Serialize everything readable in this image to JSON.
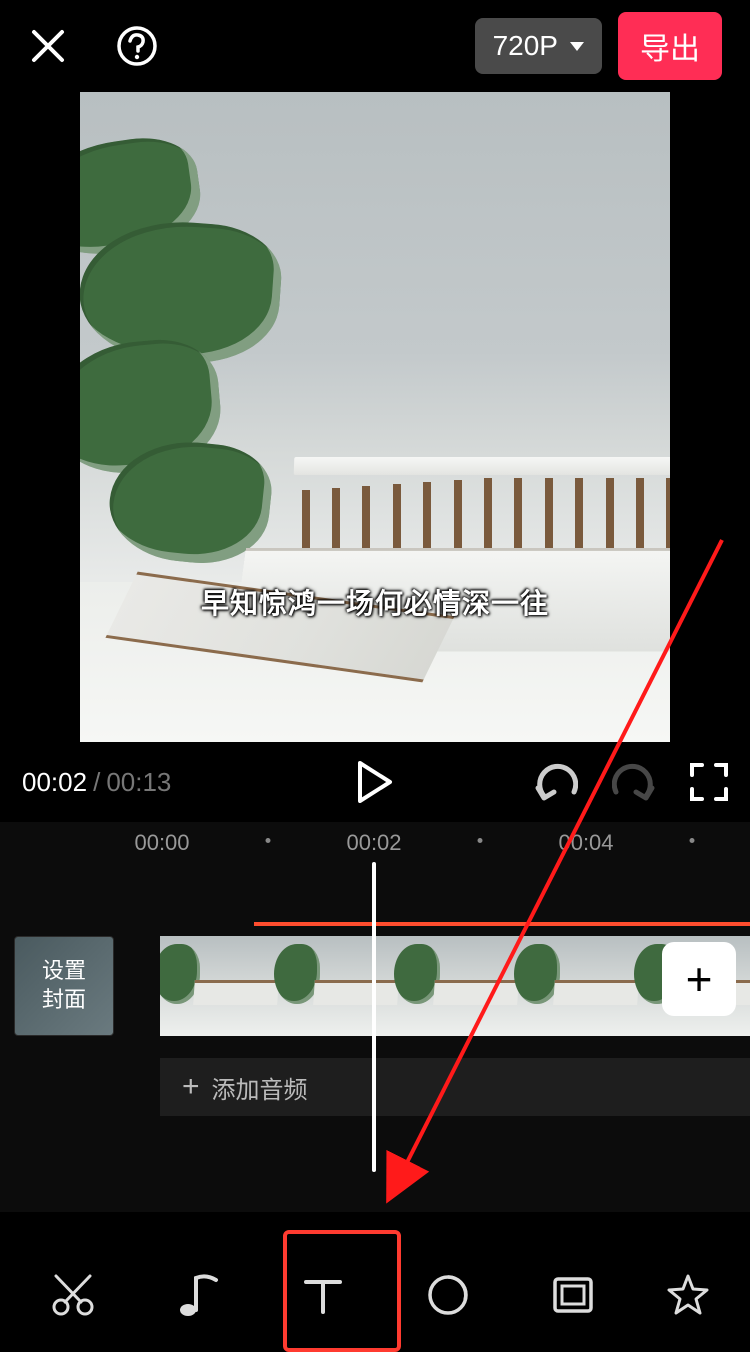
{
  "header": {
    "resolution_label": "720P",
    "export_label": "导出"
  },
  "preview": {
    "subtitle_text": "早知惊鸿一场何必情深一往"
  },
  "playback": {
    "current_time": "00:02",
    "total_time": "00:13"
  },
  "ruler": {
    "ticks": [
      "00:00",
      "00:02",
      "00:04"
    ]
  },
  "timeline": {
    "cover_label": "设置\n封面",
    "add_audio_label": "添加音频",
    "add_clip_glyph": "+"
  },
  "tools": {
    "items": [
      {
        "name": "cut",
        "icon": "scissors"
      },
      {
        "name": "audio",
        "icon": "music-note"
      },
      {
        "name": "text",
        "icon": "text-t"
      },
      {
        "name": "sticker",
        "icon": "circle-slash"
      },
      {
        "name": "overlay",
        "icon": "picture"
      },
      {
        "name": "effects",
        "icon": "star"
      }
    ],
    "highlighted_index": 2
  }
}
